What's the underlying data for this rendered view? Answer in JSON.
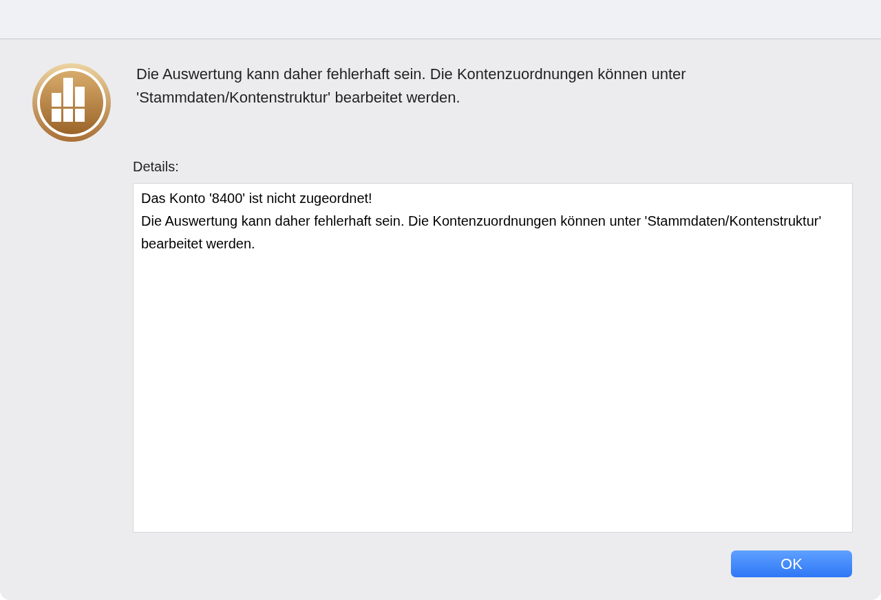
{
  "message": "Die Auswertung kann daher fehlerhaft sein. Die Kontenzuordnungen können unter 'Stammdaten/Kontenstruktur' bearbeitet werden.",
  "details_label": "Details:",
  "details_lines": [
    "Das Konto '8400' ist nicht zugeordnet!",
    "Die Auswertung kann daher fehlerhaft sein. Die Kontenzuordnungen können unter 'Stammdaten/Kontenstruktur' bearbeitet werden."
  ],
  "buttons": [
    {
      "label": "OK",
      "kind": "default"
    }
  ]
}
